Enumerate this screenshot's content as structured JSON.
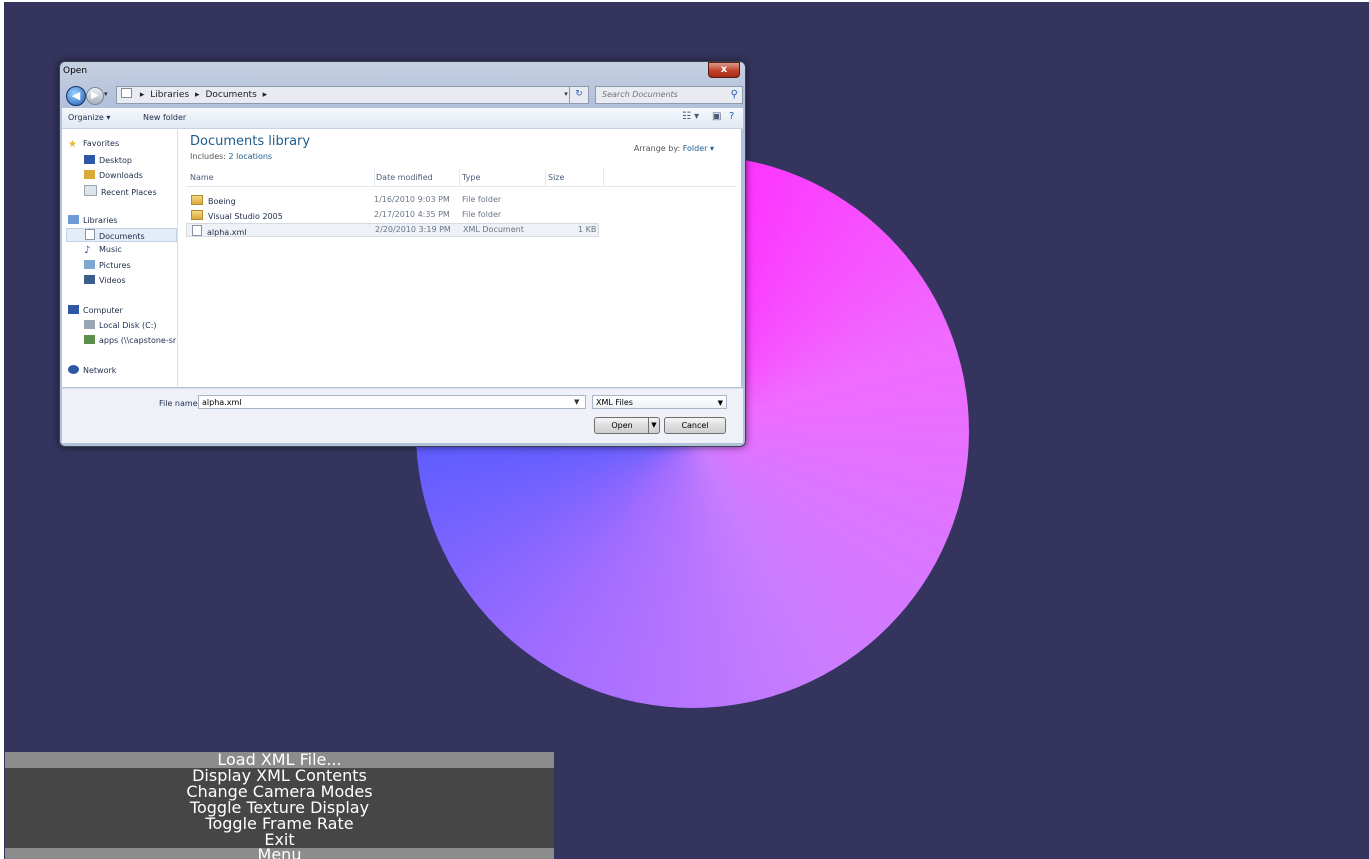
{
  "dialog": {
    "title": "Open",
    "close_label": "x",
    "breadcrumb": [
      "Libraries",
      "Documents"
    ],
    "search_placeholder": "Search Documents",
    "toolbar": {
      "organize": "Organize ▾",
      "new_folder": "New folder"
    },
    "nav": {
      "favorites": "Favorites",
      "desktop": "Desktop",
      "downloads": "Downloads",
      "recent_places": "Recent Places",
      "libraries": "Libraries",
      "documents": "Documents",
      "music": "Music",
      "pictures": "Pictures",
      "videos": "Videos",
      "computer": "Computer",
      "local_disk": "Local Disk (C:)",
      "apps": "apps (\\\\capstone-sr",
      "network": "Network"
    },
    "library": {
      "title": "Documents library",
      "includes_prefix": "Includes:",
      "includes_link": "2 locations",
      "arrange_label": "Arrange by:",
      "arrange_value": "Folder ▾"
    },
    "columns": {
      "name": "Name",
      "date": "Date modified",
      "type": "Type",
      "size": "Size"
    },
    "files": [
      {
        "name": "Boeing",
        "date": "1/16/2010 9:03 PM",
        "type": "File folder",
        "size": ""
      },
      {
        "name": "Visual Studio 2005",
        "date": "2/17/2010 4:35 PM",
        "type": "File folder",
        "size": ""
      },
      {
        "name": "alpha.xml",
        "date": "2/20/2010 3:19 PM",
        "type": "XML Document",
        "size": "1 KB"
      }
    ],
    "file_name_label": "File name:",
    "file_name_value": "alpha.xml",
    "file_type": "XML Files",
    "open_label": "Open",
    "cancel_label": "Cancel"
  },
  "menu": {
    "items": [
      "Load XML File...",
      "Display XML Contents",
      "Change Camera Modes",
      "Toggle Texture Display",
      "Toggle Frame Rate",
      "Exit",
      "Menu"
    ]
  },
  "colors": {
    "background": "#34345e",
    "menu_bg": "#464646",
    "menu_highlight": "#8c8c8c",
    "disc_magenta": "#ff2bff",
    "disc_blue": "#1a2cff"
  }
}
